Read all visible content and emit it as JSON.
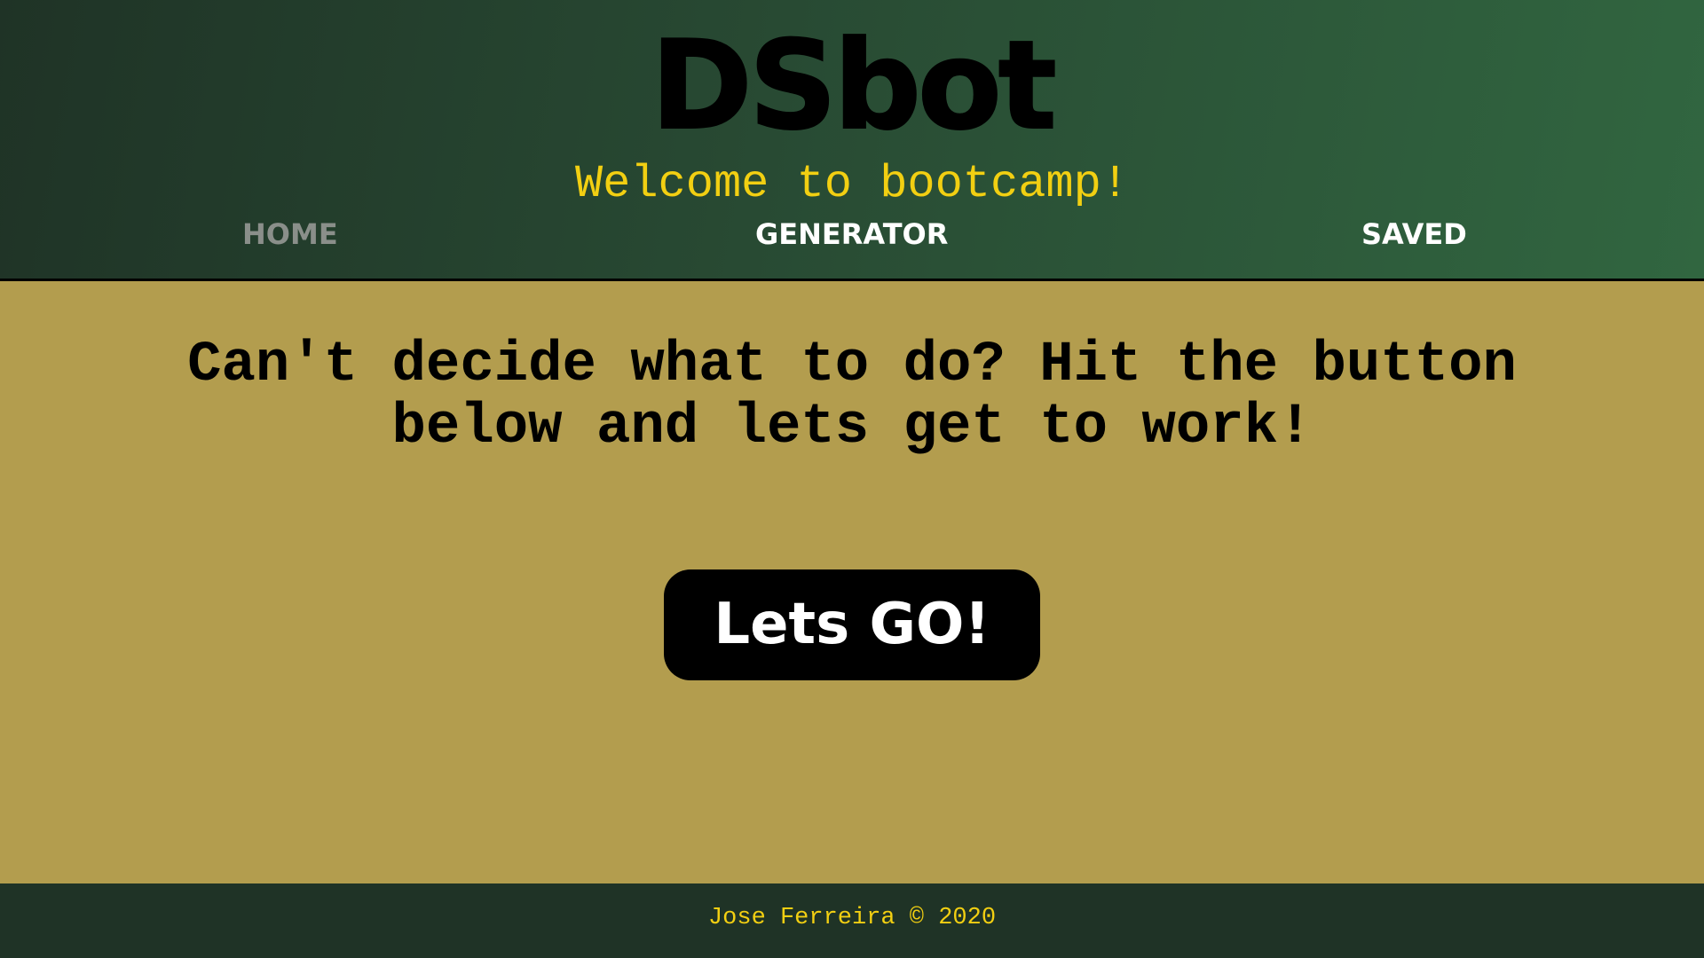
{
  "header": {
    "brand": "DSbot",
    "tagline": "Welcome to bootcamp!"
  },
  "nav": {
    "home": "HOME",
    "generator": "GENERATOR",
    "saved": "SAVED"
  },
  "main": {
    "prompt": "Can't decide what to do? Hit the button below and lets get to work!",
    "button_label": "Lets GO!"
  },
  "footer": {
    "text": "Jose Ferreira © 2020"
  },
  "colors": {
    "header_gradient_start": "#1f3326",
    "header_gradient_end": "#316640",
    "main_background": "#b39d4e",
    "accent_yellow": "#f2cf12",
    "nav_inactive": "#8a8f8a",
    "button_background": "#000000",
    "footer_background": "#1f3326"
  }
}
